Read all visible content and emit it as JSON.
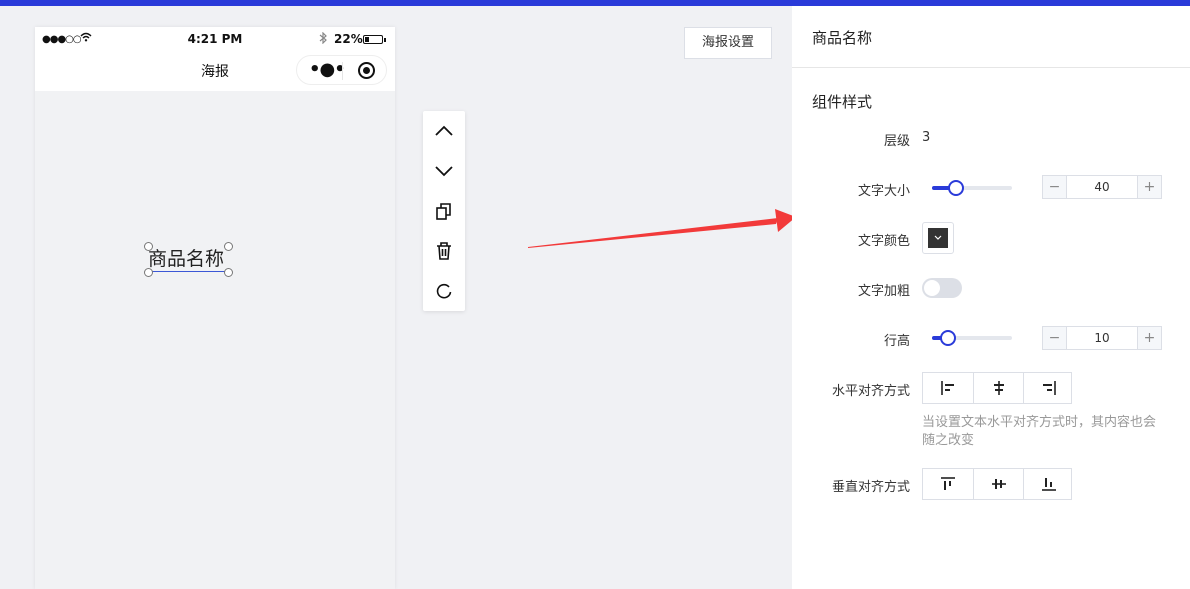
{
  "phone": {
    "signal": "●●●○○",
    "time": "4:21 PM",
    "battery": "22%",
    "battery_level": 0.22,
    "title": "海报",
    "selected_text": "商品名称"
  },
  "toolbar": {
    "items": [
      "chevron-up-icon",
      "chevron-down-icon",
      "copy-icon",
      "trash-icon",
      "refresh-icon"
    ]
  },
  "poster_settings_button": "海报设置",
  "panel": {
    "title": "商品名称",
    "section": "组件样式",
    "layer_label": "层级",
    "layer_value": "3",
    "font_size_label": "文字大小",
    "font_size_value": "40",
    "font_size_slider": 0.3,
    "color_label": "文字颜色",
    "color_value": "#333333",
    "bold_label": "文字加粗",
    "bold_on": false,
    "line_height_label": "行高",
    "line_height_value": "10",
    "line_height_slider": 0.2,
    "h_align_label": "水平对齐方式",
    "h_align_hint": "当设置文本水平对齐方式时，其内容也会随之改变",
    "v_align_label": "垂直对齐方式",
    "stepper_minus": "−",
    "stepper_plus": "+"
  },
  "colors": {
    "accent": "#2a3bd9",
    "arrow": "#f23a3a"
  }
}
